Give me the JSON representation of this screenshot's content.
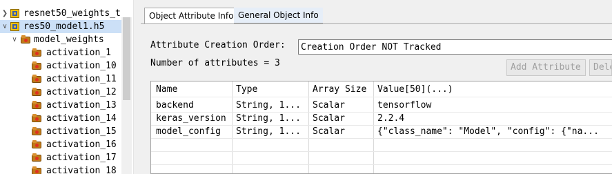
{
  "tree": {
    "items": [
      {
        "label": "resnet50_weights_t",
        "icon": "hdf5-file-icon",
        "expanded": false
      },
      {
        "label": "res50_model1.h5",
        "icon": "hdf5-file-icon",
        "expanded": true,
        "selected": true
      },
      {
        "label": "model_weights",
        "icon": "group-folder-icon",
        "expanded": true
      },
      {
        "label": "activation_1",
        "icon": "group-folder-icon"
      },
      {
        "label": "activation_10",
        "icon": "group-folder-icon"
      },
      {
        "label": "activation_11",
        "icon": "group-folder-icon"
      },
      {
        "label": "activation_12",
        "icon": "group-folder-icon"
      },
      {
        "label": "activation_13",
        "icon": "group-folder-icon"
      },
      {
        "label": "activation_14",
        "icon": "group-folder-icon"
      },
      {
        "label": "activation_15",
        "icon": "group-folder-icon"
      },
      {
        "label": "activation_16",
        "icon": "group-folder-icon"
      },
      {
        "label": "activation_17",
        "icon": "group-folder-icon"
      },
      {
        "label": "activation_18",
        "icon": "group-folder-icon"
      }
    ]
  },
  "tabs": [
    {
      "label": "Object Attribute Info",
      "active": true
    },
    {
      "label": "General Object Info",
      "active": false
    }
  ],
  "attributes": {
    "creation_order_label": "Attribute Creation Order:",
    "creation_order_value": "Creation Order NOT Tracked",
    "count_text": "Number of attributes = 3",
    "add_button": "Add Attribute",
    "delete_button": "Delete Attribute",
    "table": {
      "headers": [
        "Name",
        "Type",
        "Array Size",
        "Value[50](...)"
      ],
      "rows": [
        [
          "backend",
          "String, 1...",
          "Scalar",
          "tensorflow"
        ],
        [
          "keras_version",
          "String, 1...",
          "Scalar",
          "2.2.4"
        ],
        [
          "model_config",
          "String, 1...",
          "Scalar",
          "{\"class_name\": \"Model\", \"config\": {\"na..."
        ]
      ]
    }
  },
  "colors": {
    "selection": "#cce0f7",
    "panel_bg": "#f0f0f0",
    "inactive_tab": "#e6eef8"
  }
}
